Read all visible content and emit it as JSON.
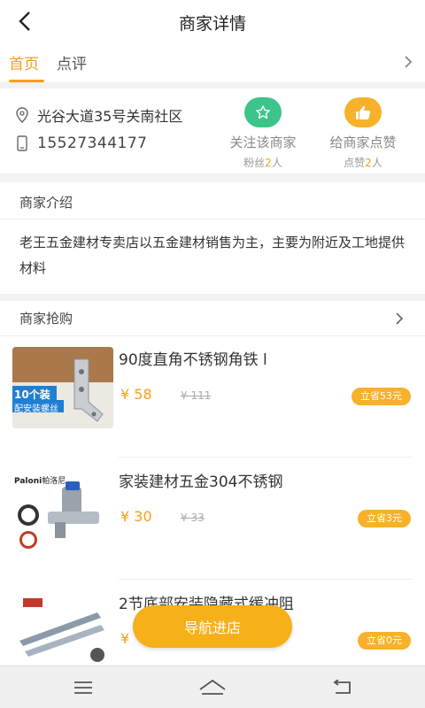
{
  "header": {
    "title": "商家详情"
  },
  "tabs": [
    {
      "label": "首页",
      "active": true
    },
    {
      "label": "点评",
      "active": false
    }
  ],
  "store": {
    "address": "光谷大道35号关南社区",
    "phone": "15527344177"
  },
  "actions": {
    "follow": {
      "label": "关注该商家",
      "count_prefix": "粉丝",
      "count": "2",
      "count_suffix": "人",
      "color": "#3cc48a"
    },
    "like": {
      "label": "给商家点赞",
      "count_prefix": "点赞",
      "count": "2",
      "count_suffix": "人",
      "color": "#f7b12a"
    }
  },
  "intro": {
    "title": "商家介绍",
    "text": "老王五金建材专卖店以五金建材销售为主，主要为附近及工地提供材料"
  },
  "sale": {
    "title": "商家抢购",
    "products": [
      {
        "name": "90度直角不锈钢角铁 l",
        "price": "¥ 58",
        "old_price": "¥ 111",
        "save": "立省53元",
        "thumb_badge": "10个装",
        "thumb_text": "配安装螺丝"
      },
      {
        "name": "家装建材五金304不锈钢",
        "price": "¥ 30",
        "old_price": "¥ 33",
        "save": "立省3元",
        "thumb_brand": "Paloni",
        "thumb_brand_cn": "帕洛尼"
      },
      {
        "name": "2节底部安装隐藏式缓冲阻",
        "price": "¥",
        "old_price": "",
        "save": "立省0元"
      }
    ]
  },
  "nav_button": "导航进店",
  "colors": {
    "accent": "#f5a01a",
    "green": "#3cc48a"
  }
}
